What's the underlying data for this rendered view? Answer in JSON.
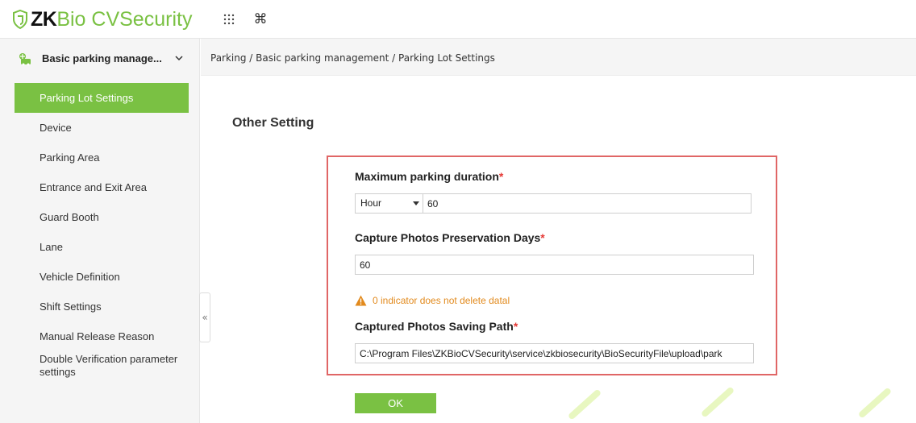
{
  "app": {
    "logo_prefix": "ZK",
    "logo_rest": "Bio CVSecurity",
    "brand_color": "#7ac143",
    "grid_icon": "grid-icon",
    "command_icon": "command-icon"
  },
  "sidebar": {
    "module_label": "Basic parking manage...",
    "module_icon": "parking-module-icon",
    "items": [
      {
        "label": "Parking Lot Settings",
        "active": true
      },
      {
        "label": "Device"
      },
      {
        "label": "Parking Area"
      },
      {
        "label": "Entrance and Exit Area"
      },
      {
        "label": "Guard Booth"
      },
      {
        "label": "Lane"
      },
      {
        "label": "Vehicle Definition"
      },
      {
        "label": "Shift Settings"
      },
      {
        "label": "Manual Release Reason"
      },
      {
        "label": "Double Verification parameter settings"
      }
    ],
    "collapse_label": "«"
  },
  "breadcrumb": "Parking / Basic parking management / Parking Lot Settings",
  "main": {
    "section_title": "Other Setting",
    "max_duration": {
      "label": "Maximum parking duration",
      "required": "*",
      "unit_selected": "Hour",
      "value": "60"
    },
    "preservation_days": {
      "label": "Capture Photos Preservation Days",
      "required": "*",
      "value": "60"
    },
    "warning_text": "0 indicator does not delete datal",
    "saving_path": {
      "label": "Captured Photos Saving Path",
      "required": "*",
      "value": "C:\\Program Files\\ZKBioCVSecurity\\service\\zkbiosecurity\\BioSecurityFile\\upload\\park"
    },
    "ok_label": "OK"
  },
  "colors": {
    "accent": "#7ac143",
    "warning": "#e28a1d",
    "required": "#e53935",
    "highlight_border": "#e06666"
  }
}
